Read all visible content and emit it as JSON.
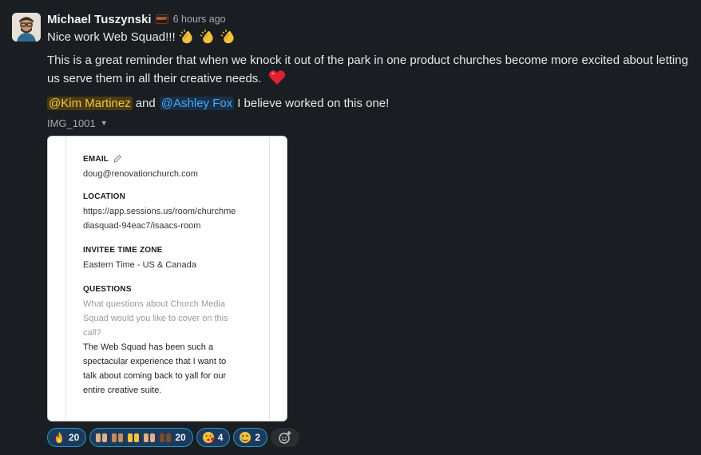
{
  "message": {
    "author": "Michael Tuszynski",
    "status_badge_text": "AWAY",
    "timestamp": "6 hours ago",
    "line1_text": "Nice work Web Squad!!!",
    "line1_emojis": [
      "clap-icon",
      "clap-icon",
      "clap-icon"
    ],
    "paragraph": "This is a great reminder that when we knock it out of the park in one product churches become more excited about letting us serve them in all their creative needs.",
    "paragraph_emoji": "heart-icon",
    "mention1": "@Kim Martinez",
    "connector": "and",
    "mention2": "@Ashley Fox",
    "mentions_tail": "I believe worked on this one!",
    "attachment_name": "IMG_1001"
  },
  "image": {
    "email_label": "EMAIL",
    "email_value": "doug@renovationchurch.com",
    "location_label": "LOCATION",
    "location_value_1": "https://app.sessions.us/room/churchme",
    "location_value_2": "diasquad-94eac7/isaacs-room",
    "tz_label": "INVITEE TIME ZONE",
    "tz_value": "Eastern Time - US & Canada",
    "questions_label": "QUESTIONS",
    "question_1": "What questions about Church Media",
    "question_2": "Squad would you like to cover on this",
    "question_3": "call?",
    "answer_1": "The Web Squad has been such a",
    "answer_2": "spectacular experience that I want to",
    "answer_3": "talk about coming back to yall for our",
    "answer_4": "entire creative suite."
  },
  "reactions": [
    {
      "icon": "fire-icon",
      "count": "20"
    },
    {
      "icon": "raised-hands-icon",
      "count": "20"
    },
    {
      "icon": "face-kiss-icon",
      "count": "4"
    },
    {
      "icon": "face-cry-icon",
      "count": "2"
    }
  ],
  "colors": {
    "background": "#1a1d21",
    "mention_kim_bg": "#4a3b12",
    "mention_ashley_bg": "#16304a",
    "reaction_bg": "#1d3a5c",
    "reaction_border": "#1d9bd1"
  }
}
